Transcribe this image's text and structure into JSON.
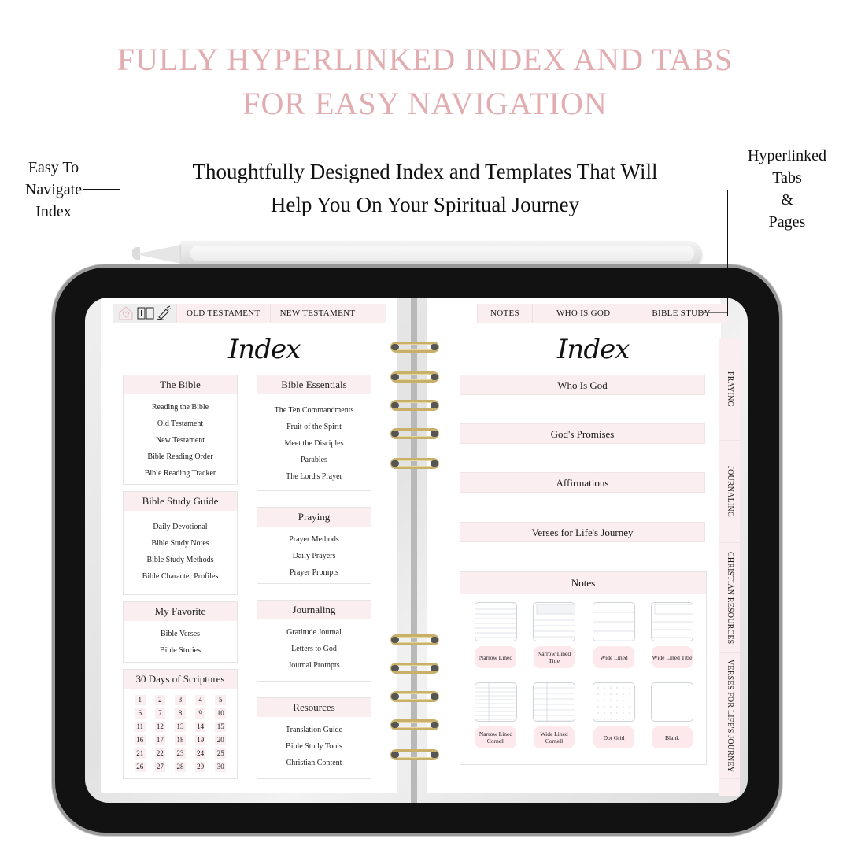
{
  "headline": {
    "line1": "FULLY HYPERLINKED INDEX AND TABS",
    "line2": "FOR EASY NAVIGATION"
  },
  "subheadline": {
    "line1": "Thoughtfully Designed Index and Templates That Will",
    "line2": "Help You On Your Spiritual Journey"
  },
  "annotations": {
    "left": [
      "Easy To",
      "Navigate",
      "Index"
    ],
    "right": [
      "Hyperlinked",
      "Tabs",
      "&",
      "Pages"
    ]
  },
  "colors": {
    "accent": "#e2adb1",
    "tab_bg": "#fbeef0",
    "bezel": "#121212",
    "ring_gold": "#c9b06a"
  },
  "left_page": {
    "nav_icons": [
      "home-heart-icon",
      "bible-book-icon",
      "pen-nib-icon"
    ],
    "tabs": [
      "OLD TESTAMENT",
      "NEW TESTAMENT"
    ],
    "title": "Index",
    "cards": [
      {
        "title": "The Bible",
        "items": [
          "Reading the Bible",
          "Old Testament",
          "New Testament",
          "Bible Reading Order",
          "Bible Reading Tracker"
        ]
      },
      {
        "title": "Bible Essentials",
        "items": [
          "The Ten Commandments",
          "Fruit of the Spirit",
          "Meet the Disciples",
          "Parables",
          "The Lord's Prayer"
        ]
      },
      {
        "title": "Bible Study Guide",
        "items": [
          "Daily Devotional",
          "Bible Study Notes",
          "Bible Study Methods",
          "Bible Character Profiles"
        ]
      },
      {
        "title": "Praying",
        "items": [
          "Prayer Methods",
          "Daily Prayers",
          "Prayer Prompts"
        ]
      },
      {
        "title": "My Favorite",
        "items": [
          "Bible Verses",
          "Bible Stories"
        ]
      },
      {
        "title": "Journaling",
        "items": [
          "Gratitude Journal",
          "Letters to God",
          "Journal Prompts"
        ]
      },
      {
        "title": "Resources",
        "items": [
          "Translation Guide",
          "Bible Study Tools",
          "Christian Content"
        ]
      }
    ],
    "scriptures": {
      "title": "30 Days of Scriptures",
      "days": [
        "1",
        "2",
        "3",
        "4",
        "5",
        "6",
        "7",
        "8",
        "9",
        "10",
        "11",
        "12",
        "13",
        "14",
        "15",
        "16",
        "17",
        "18",
        "19",
        "20",
        "21",
        "22",
        "23",
        "24",
        "25",
        "26",
        "27",
        "28",
        "29",
        "30"
      ]
    }
  },
  "right_page": {
    "tabs": [
      "NOTES",
      "WHO IS GOD",
      "BIBLE STUDY"
    ],
    "title": "Index",
    "sections": [
      "Who Is God",
      "God's Promises",
      "Affirmations",
      "Verses for Life's Journey"
    ],
    "notes": {
      "title": "Notes",
      "templates": [
        {
          "label": "Narrow Lined",
          "pattern": "narrow-lined"
        },
        {
          "label": "Narrow Lined Title",
          "pattern": "narrow-lined-title"
        },
        {
          "label": "Wide Lined",
          "pattern": "wide-lined"
        },
        {
          "label": "Wide Lined Title",
          "pattern": "wide-lined-title"
        },
        {
          "label": "Narrow Lined Cornell",
          "pattern": "narrow-cornell"
        },
        {
          "label": "Wide Lined Cornell",
          "pattern": "wide-cornell"
        },
        {
          "label": "Dot Grid",
          "pattern": "dot-grid"
        },
        {
          "label": "Blank",
          "pattern": "blank"
        }
      ]
    },
    "side_tabs": [
      "PRAYING",
      "JOURNALING",
      "CHRISTIAN RESOURCES",
      "VERSES FOR LIFE'S JOURNEY"
    ]
  }
}
